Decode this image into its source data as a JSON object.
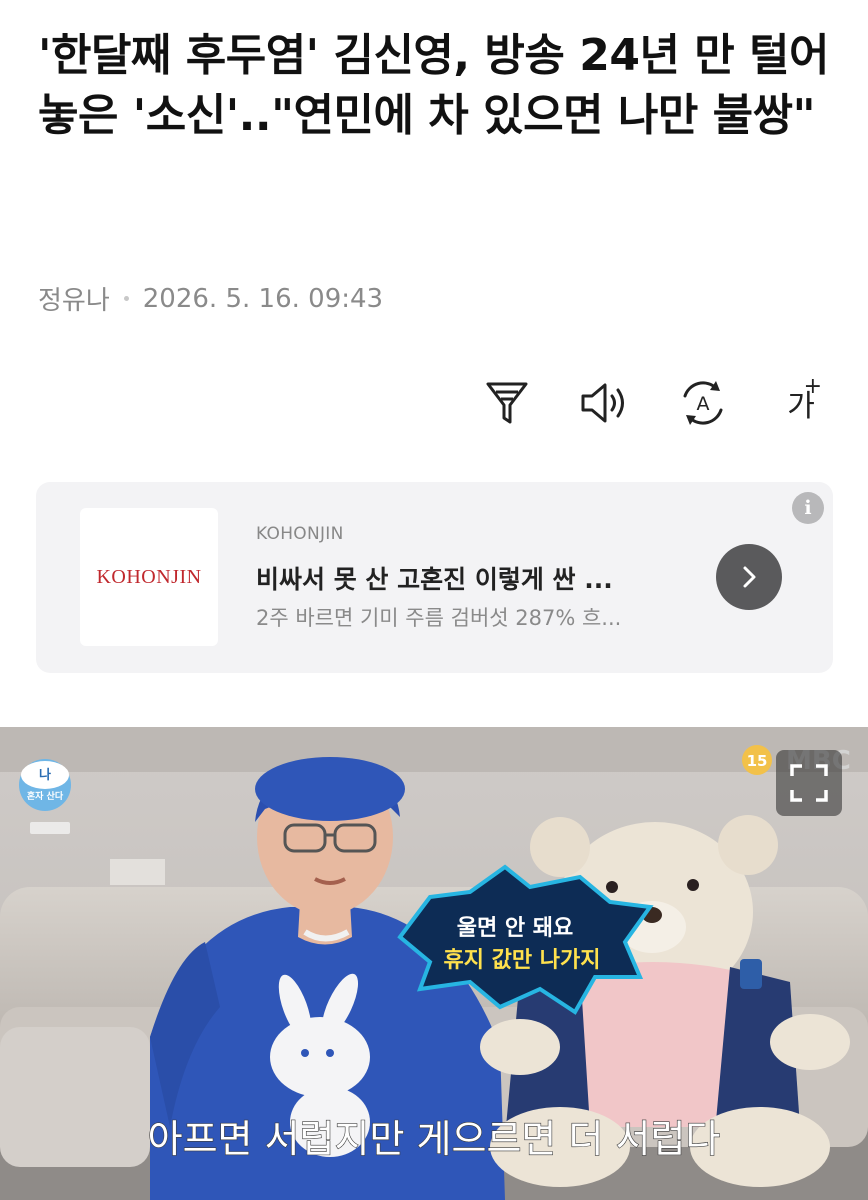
{
  "article": {
    "headline": "'한달째 후두염' 김신영, 방송 24년 만 털어놓은 '소신'..\"연민에 차 있으면 나만 불쌍\"",
    "author": "정유나",
    "datetime": "2026. 5. 16. 09:43"
  },
  "toolbar": {
    "summary_icon": "funnel-icon",
    "listen_icon": "speaker-icon",
    "translate_icon": "translate-icon",
    "font_size_label": "가",
    "font_size_plus": "+"
  },
  "ad": {
    "logo_text": "KOHONJIN",
    "brand": "KOHONJIN",
    "title": "비싸서 못 산 고혼진 이렇게 싼 ...",
    "description": "2주 바르면 기미 주름 검버섯 287% 흐...",
    "info_label": "i"
  },
  "photo": {
    "channel_badge_top": "나",
    "channel_badge_bottom": "혼자 산다",
    "rating_badge": "15",
    "broadcaster": "MBC",
    "caption_bubble_line1": "울면 안 돼요",
    "caption_bubble_line2": "휴지 값만 나가지",
    "subtitle": "아프면 서럽지만 게으르면 더 서럽다"
  },
  "colors": {
    "ad_background": "#f3f3f5",
    "ad_logo_red": "#c0282d",
    "arrow_button": "#5a5a5c",
    "subtitle_text": "#ffffff"
  }
}
